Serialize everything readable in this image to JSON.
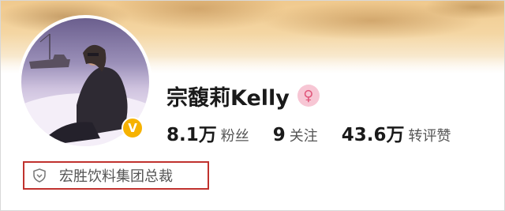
{
  "profile": {
    "name": "宗馥莉Kelly",
    "gender_icon": "female-symbol-icon",
    "verified_badge_label": "V",
    "stats": [
      {
        "value": "8.1万",
        "label": "粉丝"
      },
      {
        "value": "9",
        "label": "关注"
      },
      {
        "value": "43.6万",
        "label": "转评赞"
      }
    ],
    "title": "宏胜饮料集团总裁"
  },
  "colors": {
    "verified_badge": "#f6b200",
    "gender_badge_bg": "#f7c6d4",
    "gender_icon": "#e0567a",
    "highlight_border": "#c0322e"
  }
}
